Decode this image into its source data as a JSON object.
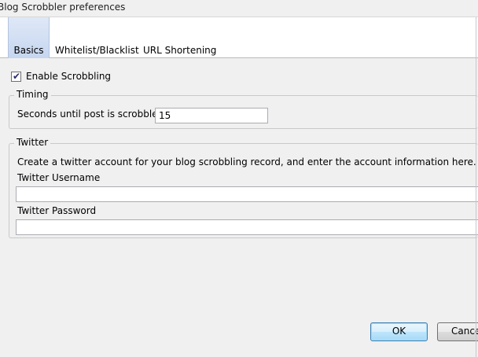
{
  "window": {
    "title": "Blog Scrobbler preferences"
  },
  "tabs": [
    {
      "label": "Basics",
      "active": true
    },
    {
      "label": "Whitelist/Blacklist",
      "active": false
    },
    {
      "label": "URL Shortening",
      "active": false
    }
  ],
  "basics": {
    "enable_scrobbling": {
      "label": "Enable Scrobbling",
      "checked": true,
      "check_glyph": "✔"
    },
    "timing": {
      "legend": "Timing",
      "seconds_label": "Seconds until post is scrobbled.",
      "seconds_value": "15"
    },
    "twitter": {
      "legend": "Twitter",
      "description": "Create a twitter account for your blog scrobbling record, and enter the account information here.",
      "username_label": "Twitter Username",
      "username_value": "",
      "password_label": "Twitter Password",
      "password_value": ""
    }
  },
  "buttons": {
    "ok": "OK",
    "cancel": "Cance"
  },
  "colors": {
    "active_tab": "#c6d6f0",
    "default_button_border": "#3c7fb1"
  }
}
